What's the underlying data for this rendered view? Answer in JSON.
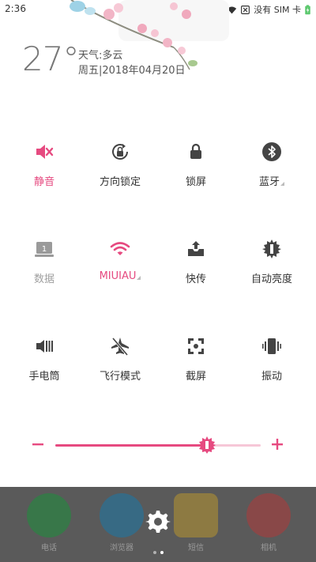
{
  "status_bar": {
    "time": "2:36",
    "carrier": "没有 SIM 卡",
    "icons": [
      "bell-off-icon",
      "wifi-icon",
      "no-sim-icon",
      "battery-charging-icon"
    ]
  },
  "weather": {
    "temperature": "27°",
    "condition": "天气:多云",
    "date": "周五|2018年04月20日"
  },
  "toggles": [
    {
      "label": "静音",
      "icon": "mute-icon",
      "state": "on"
    },
    {
      "label": "方向锁定",
      "icon": "rotation-lock-icon",
      "state": "normal"
    },
    {
      "label": "锁屏",
      "icon": "lock-icon",
      "state": "normal"
    },
    {
      "label": "蓝牙",
      "icon": "bluetooth-icon",
      "state": "normal"
    },
    {
      "label": "数据",
      "icon": "mobile-data-icon",
      "state": "disabled"
    },
    {
      "label": "MIUIAU",
      "icon": "wifi-icon",
      "state": "on"
    },
    {
      "label": "快传",
      "icon": "quick-transfer-icon",
      "state": "normal"
    },
    {
      "label": "自动亮度",
      "icon": "auto-brightness-icon",
      "state": "normal"
    },
    {
      "label": "手电筒",
      "icon": "flashlight-icon",
      "state": "normal"
    },
    {
      "label": "飞行模式",
      "icon": "airplane-off-icon",
      "state": "normal"
    },
    {
      "label": "截屏",
      "icon": "screenshot-icon",
      "state": "normal"
    },
    {
      "label": "振动",
      "icon": "vibrate-icon",
      "state": "normal"
    }
  ],
  "brightness": {
    "value": 0.74
  },
  "dock": {
    "apps": [
      "电话",
      "浏览器",
      "短信",
      "相机"
    ]
  },
  "colors": {
    "accent": "#e64a80",
    "text": "#333333",
    "disabled": "#a0a0a0"
  }
}
